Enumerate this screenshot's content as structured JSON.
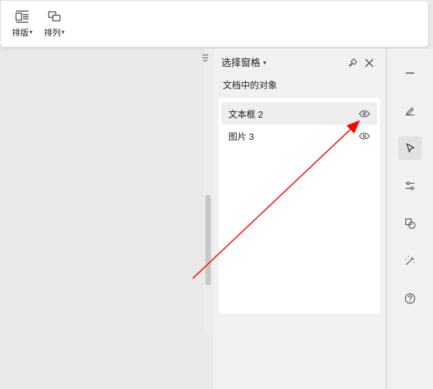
{
  "ribbon": {
    "layout": {
      "label": "排版"
    },
    "arrange": {
      "label": "排列"
    }
  },
  "pane": {
    "title": "选择窗格",
    "subtitle": "文档中的对象",
    "items": [
      {
        "label": "文本框 2"
      },
      {
        "label": "图片 3"
      }
    ]
  }
}
